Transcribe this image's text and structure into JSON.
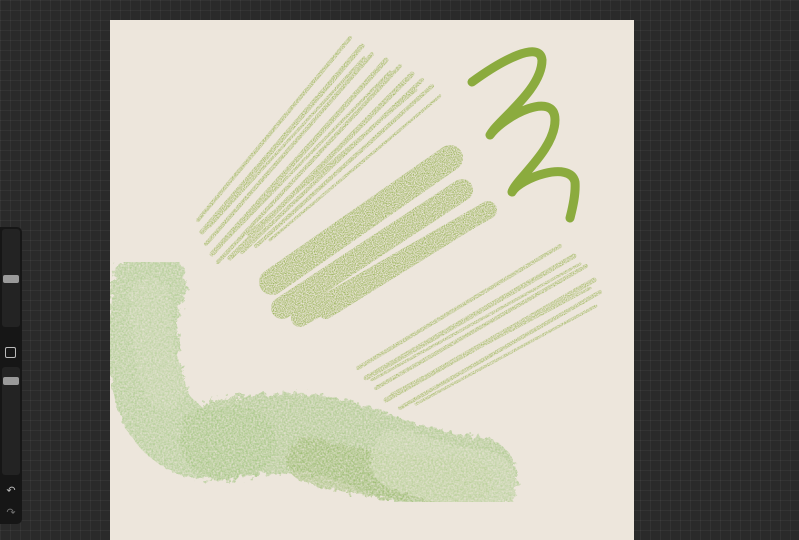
{
  "app": {
    "name": "drawing-canvas"
  },
  "colors": {
    "background": "#2a2a2a",
    "canvas": "#ede6dc",
    "pencil_green": "#8aaa3c",
    "stroke_green": "#8bab3e",
    "light_green": "#a8c98a",
    "pale_green": "#c2d6a6",
    "sidebar": "#161616"
  },
  "sidebar": {
    "brush_size_level": 0.5,
    "brush_opacity_level": 0.95,
    "modify_icon": "square-outline-icon",
    "undo_icon": "undo-arrow-icon",
    "redo_icon": "redo-arrow-icon"
  },
  "artwork": {
    "strokes": [
      "pencil-hatching-upper-left",
      "charcoal-block-center",
      "marker-zigzag",
      "pencil-hatching-right",
      "watercolor-l-stroke"
    ]
  }
}
